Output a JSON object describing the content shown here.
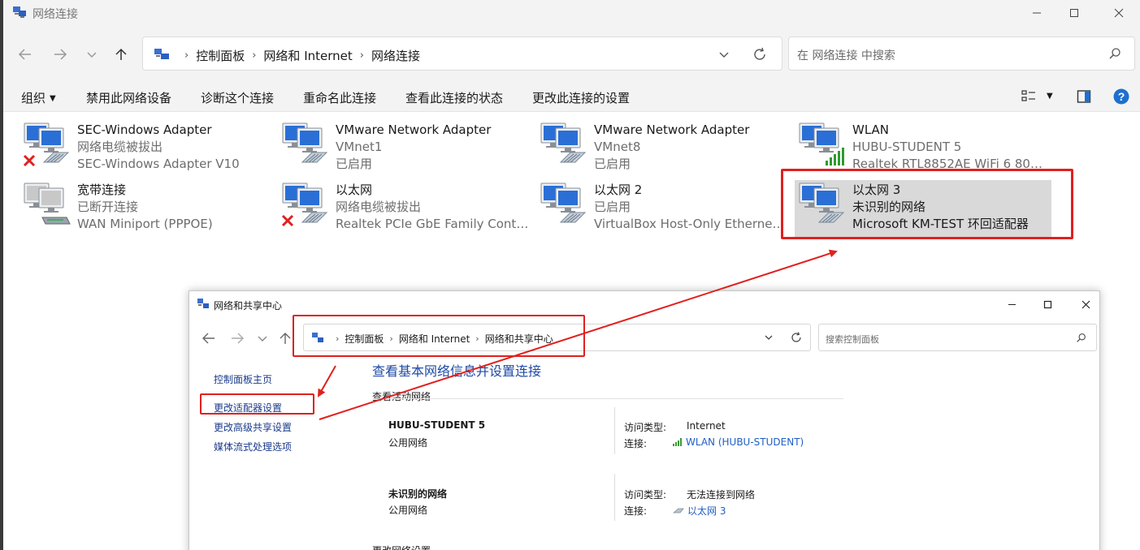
{
  "window": {
    "title": "网络连接",
    "address": [
      "控制面板",
      "网络和 Internet",
      "网络连接"
    ],
    "search_placeholder": "在 网络连接 中搜索"
  },
  "toolbar": {
    "organize": "组织",
    "disable": "禁用此网络设备",
    "diagnose": "诊断这个连接",
    "rename": "重命名此连接",
    "status": "查看此连接的状态",
    "settings": "更改此连接的设置"
  },
  "adapters": [
    {
      "name": "SEC-Windows Adapter",
      "status": "网络电缆被拔出",
      "device": "SEC-Windows Adapter V10",
      "state": "disconnected"
    },
    {
      "name": "VMware Network Adapter",
      "status": "VMnet1",
      "device": "已启用",
      "state": "enabled"
    },
    {
      "name": "VMware Network Adapter",
      "status": "VMnet8",
      "device": "已启用",
      "state": "enabled"
    },
    {
      "name": "WLAN",
      "status": "HUBU-STUDENT 5",
      "device": "Realtek RTL8852AE WiFi 6 802....",
      "state": "wifi"
    },
    {
      "name": "宽带连接",
      "status": "已断开连接",
      "device": "WAN Miniport (PPPOE)",
      "state": "dialup"
    },
    {
      "name": "以太网",
      "status": "网络电缆被拔出",
      "device": "Realtek PCIe GbE Family Contr...",
      "state": "disconnected"
    },
    {
      "name": "以太网 2",
      "status": "已启用",
      "device": "VirtualBox Host-Only Ethernet ...",
      "state": "enabled"
    },
    {
      "name": "以太网 3",
      "status": "未识别的网络",
      "device": "Microsoft KM-TEST 环回适配器",
      "state": "enabled",
      "selected": true
    }
  ],
  "inner": {
    "title": "网络和共享中心",
    "address": [
      "控制面板",
      "网络和 Internet",
      "网络和共享中心"
    ],
    "search_placeholder": "搜索控制面板",
    "sidebar": [
      "控制面板主页",
      "更改适配器设置",
      "更改高级共享设置",
      "媒体流式处理选项"
    ],
    "heading": "查看基本网络信息并设置连接",
    "active_label": "查看活动网络",
    "networks": [
      {
        "name": "HUBU-STUDENT 5",
        "type": "公用网络",
        "access_label": "访问类型:",
        "access": "Internet",
        "conn_label": "连接:",
        "conn": "WLAN (HUBU-STUDENT)"
      },
      {
        "name": "未识别的网络",
        "type": "公用网络",
        "access_label": "访问类型:",
        "access": "无法连接到网络",
        "conn_label": "连接:",
        "conn": "以太网 3"
      }
    ],
    "bottom": "更改网络设置"
  },
  "colors": {
    "highlight": "#e0201f",
    "link": "#1f5fc4",
    "selected_bg": "#d9d9d9"
  }
}
